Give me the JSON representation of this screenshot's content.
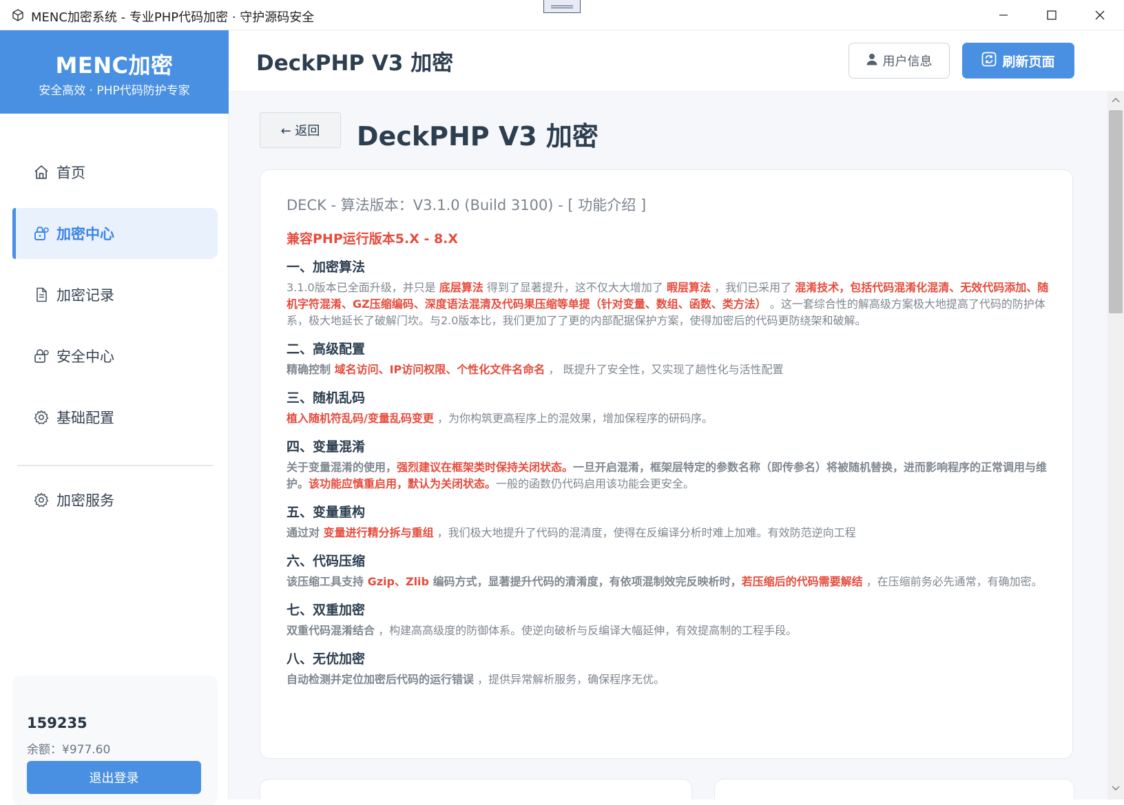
{
  "window": {
    "title": "MENC加密系统 - 专业PHP代码加密 · 守护源码安全",
    "icon": "cube-icon"
  },
  "sidebar": {
    "brand_name": "MENC加密",
    "brand_slogan": "安全高效 · PHP代码防护专家",
    "items": [
      {
        "label": "首页",
        "icon": "home-icon"
      },
      {
        "label": "加密中心",
        "icon": "lock-icon",
        "active": true
      },
      {
        "label": "加密记录",
        "icon": "document-icon"
      },
      {
        "label": "安全中心",
        "icon": "lock-icon"
      },
      {
        "label": "基础配置",
        "icon": "gear-icon"
      },
      {
        "label": "加密服务",
        "icon": "gear-icon"
      }
    ],
    "user": {
      "id": "159235",
      "balance": "余额：¥977.60",
      "logout_label": "退出登录"
    }
  },
  "header": {
    "title": "DeckPHP V3 加密",
    "user_info_label": "用户信息",
    "refresh_label": "刷新页面"
  },
  "content": {
    "back_label": "← 返回",
    "title": "DeckPHP V3 加密",
    "version_line": "DECK - 算法版本：V3.1.0 (Build 3100) - [ 功能介绍 ]",
    "compat": "兼容PHP运行版本5.X - 8.X",
    "sections": [
      {
        "title": "一、加密算法",
        "p1": "3.1.0版本已全面升级，并只是 ",
        "h1": "底层算法",
        "p2": " 得到了显著提升，这不仅大大增加了 ",
        "h2": "暇层算法",
        "p3": " ，我们已采用了 ",
        "h3": "混淆技术，包括代码混淆化混清、无效代码添加、随机字符混淆、GZ压缩编码、深度语法混清及代码果压缩等单提（针对变量、数组、函数、类方法）",
        "p4": " 。这一套综合性的解高级方案极大地提高了代码的防护体系，极大地延长了破解门坎。与2.0版本比，我们更加了了更的内部配据保护方案，使得加密后的代码更防绕架和破解。"
      },
      {
        "title": "二、高级配置",
        "p1": "精确控制 ",
        "h1": "域名访问、IP访问权限、个性化文件名命名",
        "p2": " ， 既提升了安全性，又实现了趟性化与活性配置"
      },
      {
        "title": "三、随机乱码",
        "h1": "植入随机符乱码/变量乱码变更",
        "p1": " ，为你构筑更高程序上的混效果，增加保程序的研码序。"
      },
      {
        "title": "四、变量混淆",
        "p1": "关于变量混淆的使用，",
        "h1": "强烈建议在框架类时保持关闭状态。",
        "p2": "一旦开启混淆，框架层特定的参数名称（即传参名）将被随机替换，进而影响程序的正常调用与维护。",
        "h2": "该功能应慎重启用，默认为关闭状态。",
        "p3": "一般的函数仍代码启用该功能会更安全。"
      },
      {
        "title": "五、变量重构",
        "p1": "通过对 ",
        "h1": "变量进行精分拆与重组",
        "p2": " ，我们极大地提升了代码的混清度，使得在反编译分析时难上加难。有效防范逆向工程"
      },
      {
        "title": "六、代码压缩",
        "p1": "该压缩工具支持 ",
        "h1": "Gzip、Zlib",
        "p2": " 编码方式，显著提升代码的清淆度，有依项混制效完反映析时，",
        "h2": "若压缩后的代码需要解结",
        "p3": " ，在压缩前务必先通常，有确加密。"
      },
      {
        "title": "七、双重加密",
        "p1": "双重代码混淆结合",
        "p2": " ，构建高高级度的防御体系。使逆向破析与反编译大幅延伸，有效提高制的工程手段。"
      },
      {
        "title": "八、无优加密",
        "p1": "自动检测并定位加密后代码的运行错误",
        "p2": " ，提供异常解析服务，确保程序无优。"
      }
    ]
  }
}
